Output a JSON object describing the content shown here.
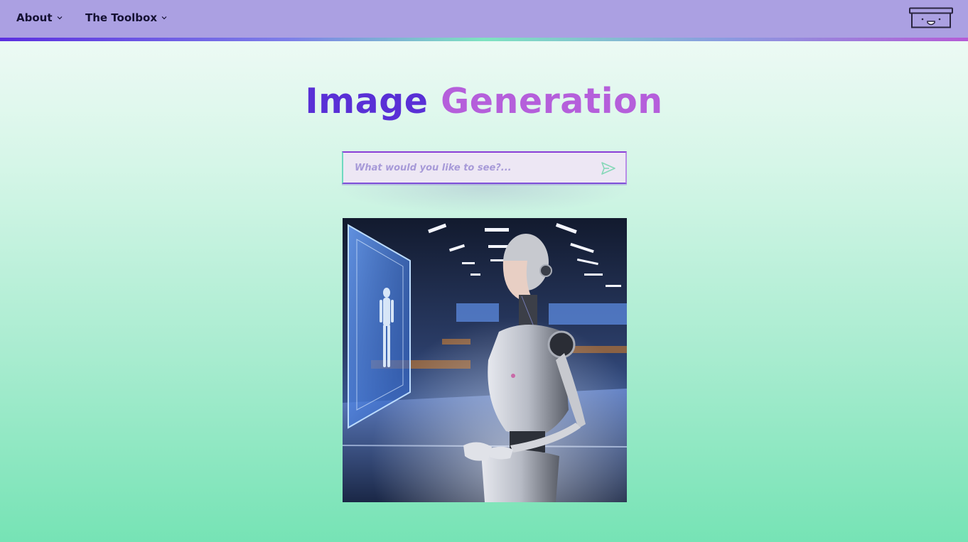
{
  "nav": {
    "items": [
      {
        "label": "About",
        "icon": "chevron-down-icon"
      },
      {
        "label": "The Toolbox",
        "icon": "chevron-down-icon"
      }
    ],
    "logo_icon": "box-face-icon"
  },
  "hero": {
    "title_word1": "Image",
    "title_word2": "Generation"
  },
  "search": {
    "placeholder": "What would you like to see?...",
    "value": "",
    "send_icon": "send-icon"
  },
  "image": {
    "alt": "Generated image: humanoid robot beside holographic display in a futuristic lab"
  },
  "colors": {
    "topbar": "#aba0e2",
    "accent_purple": "#5930d6",
    "accent_violet": "#b55fdb",
    "background_green": "#76e3b5"
  }
}
